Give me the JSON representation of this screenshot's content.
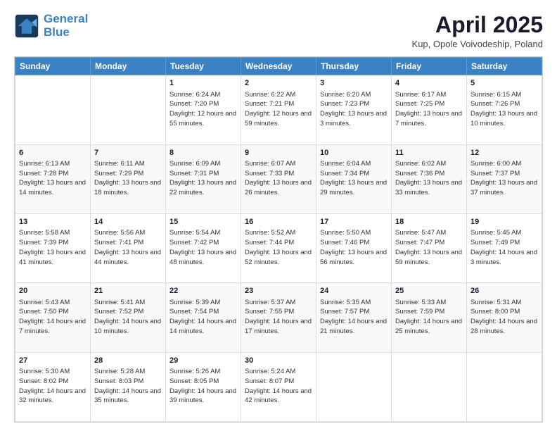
{
  "header": {
    "logo_line1": "General",
    "logo_line2": "Blue",
    "title": "April 2025",
    "subtitle": "Kup, Opole Voivodeship, Poland"
  },
  "weekdays": [
    "Sunday",
    "Monday",
    "Tuesday",
    "Wednesday",
    "Thursday",
    "Friday",
    "Saturday"
  ],
  "weeks": [
    [
      {
        "day": "",
        "info": ""
      },
      {
        "day": "",
        "info": ""
      },
      {
        "day": "1",
        "info": "Sunrise: 6:24 AM\nSunset: 7:20 PM\nDaylight: 12 hours and 55 minutes."
      },
      {
        "day": "2",
        "info": "Sunrise: 6:22 AM\nSunset: 7:21 PM\nDaylight: 12 hours and 59 minutes."
      },
      {
        "day": "3",
        "info": "Sunrise: 6:20 AM\nSunset: 7:23 PM\nDaylight: 13 hours and 3 minutes."
      },
      {
        "day": "4",
        "info": "Sunrise: 6:17 AM\nSunset: 7:25 PM\nDaylight: 13 hours and 7 minutes."
      },
      {
        "day": "5",
        "info": "Sunrise: 6:15 AM\nSunset: 7:26 PM\nDaylight: 13 hours and 10 minutes."
      }
    ],
    [
      {
        "day": "6",
        "info": "Sunrise: 6:13 AM\nSunset: 7:28 PM\nDaylight: 13 hours and 14 minutes."
      },
      {
        "day": "7",
        "info": "Sunrise: 6:11 AM\nSunset: 7:29 PM\nDaylight: 13 hours and 18 minutes."
      },
      {
        "day": "8",
        "info": "Sunrise: 6:09 AM\nSunset: 7:31 PM\nDaylight: 13 hours and 22 minutes."
      },
      {
        "day": "9",
        "info": "Sunrise: 6:07 AM\nSunset: 7:33 PM\nDaylight: 13 hours and 26 minutes."
      },
      {
        "day": "10",
        "info": "Sunrise: 6:04 AM\nSunset: 7:34 PM\nDaylight: 13 hours and 29 minutes."
      },
      {
        "day": "11",
        "info": "Sunrise: 6:02 AM\nSunset: 7:36 PM\nDaylight: 13 hours and 33 minutes."
      },
      {
        "day": "12",
        "info": "Sunrise: 6:00 AM\nSunset: 7:37 PM\nDaylight: 13 hours and 37 minutes."
      }
    ],
    [
      {
        "day": "13",
        "info": "Sunrise: 5:58 AM\nSunset: 7:39 PM\nDaylight: 13 hours and 41 minutes."
      },
      {
        "day": "14",
        "info": "Sunrise: 5:56 AM\nSunset: 7:41 PM\nDaylight: 13 hours and 44 minutes."
      },
      {
        "day": "15",
        "info": "Sunrise: 5:54 AM\nSunset: 7:42 PM\nDaylight: 13 hours and 48 minutes."
      },
      {
        "day": "16",
        "info": "Sunrise: 5:52 AM\nSunset: 7:44 PM\nDaylight: 13 hours and 52 minutes."
      },
      {
        "day": "17",
        "info": "Sunrise: 5:50 AM\nSunset: 7:46 PM\nDaylight: 13 hours and 56 minutes."
      },
      {
        "day": "18",
        "info": "Sunrise: 5:47 AM\nSunset: 7:47 PM\nDaylight: 13 hours and 59 minutes."
      },
      {
        "day": "19",
        "info": "Sunrise: 5:45 AM\nSunset: 7:49 PM\nDaylight: 14 hours and 3 minutes."
      }
    ],
    [
      {
        "day": "20",
        "info": "Sunrise: 5:43 AM\nSunset: 7:50 PM\nDaylight: 14 hours and 7 minutes."
      },
      {
        "day": "21",
        "info": "Sunrise: 5:41 AM\nSunset: 7:52 PM\nDaylight: 14 hours and 10 minutes."
      },
      {
        "day": "22",
        "info": "Sunrise: 5:39 AM\nSunset: 7:54 PM\nDaylight: 14 hours and 14 minutes."
      },
      {
        "day": "23",
        "info": "Sunrise: 5:37 AM\nSunset: 7:55 PM\nDaylight: 14 hours and 17 minutes."
      },
      {
        "day": "24",
        "info": "Sunrise: 5:35 AM\nSunset: 7:57 PM\nDaylight: 14 hours and 21 minutes."
      },
      {
        "day": "25",
        "info": "Sunrise: 5:33 AM\nSunset: 7:59 PM\nDaylight: 14 hours and 25 minutes."
      },
      {
        "day": "26",
        "info": "Sunrise: 5:31 AM\nSunset: 8:00 PM\nDaylight: 14 hours and 28 minutes."
      }
    ],
    [
      {
        "day": "27",
        "info": "Sunrise: 5:30 AM\nSunset: 8:02 PM\nDaylight: 14 hours and 32 minutes."
      },
      {
        "day": "28",
        "info": "Sunrise: 5:28 AM\nSunset: 8:03 PM\nDaylight: 14 hours and 35 minutes."
      },
      {
        "day": "29",
        "info": "Sunrise: 5:26 AM\nSunset: 8:05 PM\nDaylight: 14 hours and 39 minutes."
      },
      {
        "day": "30",
        "info": "Sunrise: 5:24 AM\nSunset: 8:07 PM\nDaylight: 14 hours and 42 minutes."
      },
      {
        "day": "",
        "info": ""
      },
      {
        "day": "",
        "info": ""
      },
      {
        "day": "",
        "info": ""
      }
    ]
  ]
}
